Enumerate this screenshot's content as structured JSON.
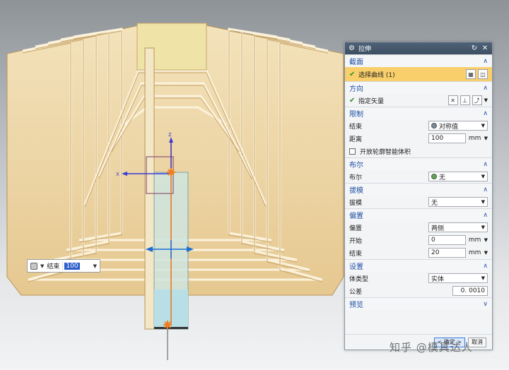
{
  "dialog": {
    "title": "拉伸",
    "sections": {
      "section": {
        "title": "截面",
        "select_curve": "选择曲线 (1)"
      },
      "direction": {
        "title": "方向",
        "vector": "指定矢量"
      },
      "limits": {
        "title": "限制",
        "end_label": "结束",
        "end_value": "对称值",
        "distance_label": "距离",
        "distance_value": "100",
        "distance_unit": "mm",
        "open_profile": "开放轮廓智能体积"
      },
      "boolean": {
        "title": "布尔",
        "label": "布尔",
        "value": "无"
      },
      "draft": {
        "title": "拔模",
        "label": "拔模",
        "value": "无"
      },
      "offset": {
        "title": "偏置",
        "offset_label": "偏置",
        "offset_value": "两侧",
        "start_label": "开始",
        "start_value": "0",
        "start_unit": "mm",
        "end_label": "结束",
        "end_value": "20",
        "end_unit": "mm"
      },
      "settings": {
        "title": "设置",
        "body_type_label": "体类型",
        "body_type_value": "实体",
        "tolerance_label": "公差",
        "tolerance_value": "0. 0010"
      },
      "preview": {
        "title": "预览"
      }
    },
    "ok_label": "< 确定 >",
    "cancel_label": "取消"
  },
  "canvas": {
    "input_label": "结束",
    "input_value": "100",
    "axis_z": "Z",
    "axis_x": "X",
    "model_color": "#f2ddb0",
    "edge_color": "#c9a66b",
    "extrude_color": "#b9dfe6"
  },
  "watermark": "知乎 @模具达人",
  "icons": {
    "title": "gear-icon",
    "selected": "check-icon",
    "collapse": "chevron-up-icon",
    "expand": "chevron-down-icon"
  }
}
